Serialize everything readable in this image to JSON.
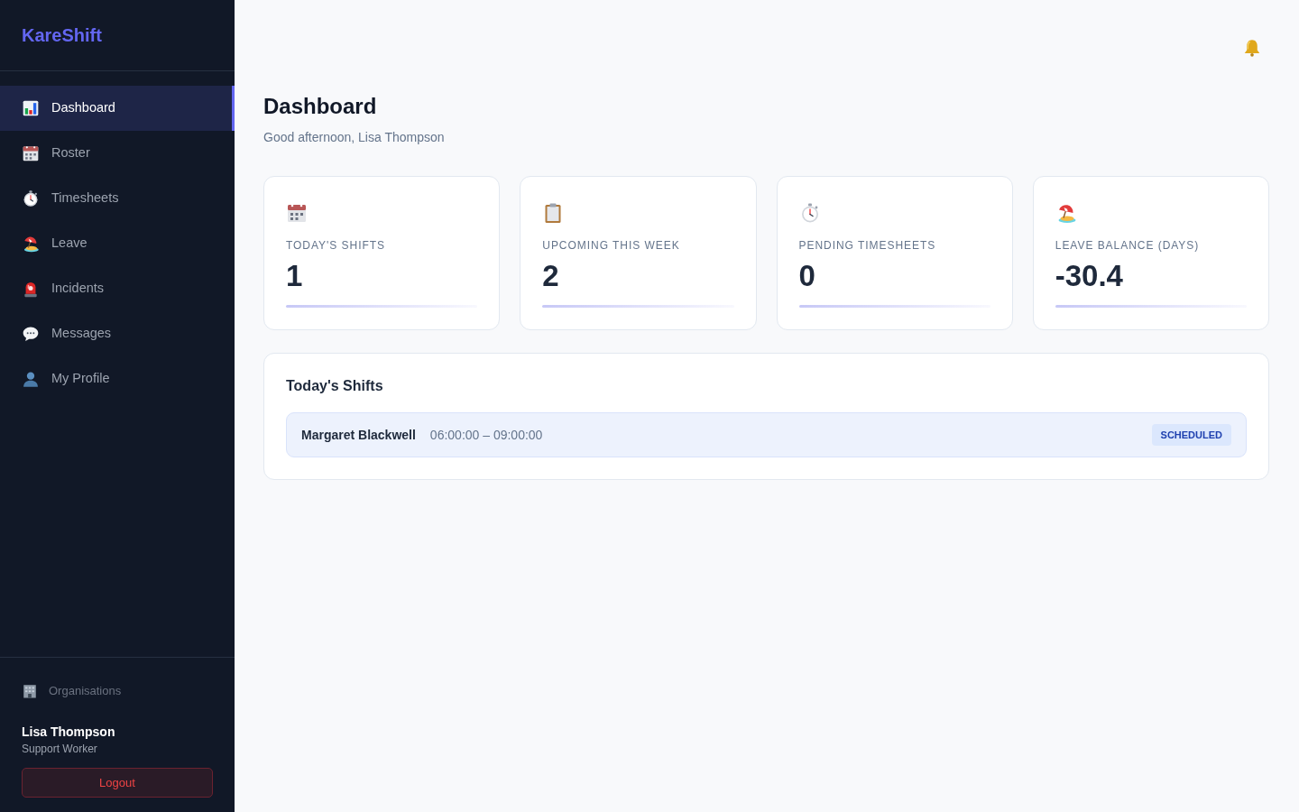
{
  "sidebar": {
    "brand": "KareShift",
    "nav_items": [
      {
        "label": "Dashboard",
        "selected": true
      },
      {
        "label": "Roster",
        "selected": false
      },
      {
        "label": "Timesheets",
        "selected": false
      },
      {
        "label": "Leave",
        "selected": false
      },
      {
        "label": "Incidents",
        "selected": false
      },
      {
        "label": "Messages",
        "selected": false
      },
      {
        "label": "My Profile",
        "selected": false
      }
    ],
    "organisations": "Organisations",
    "user": {
      "name": "Lisa Thompson",
      "role": "Support Worker"
    },
    "logout": "Logout"
  },
  "page": {
    "title": "Dashboard",
    "greeting": "Good afternoon, Lisa Thompson"
  },
  "stats": [
    {
      "label": "TODAY'S SHIFTS",
      "value": "1"
    },
    {
      "label": "UPCOMING THIS WEEK",
      "value": "2"
    },
    {
      "label": "PENDING TIMESHEETS",
      "value": "0"
    },
    {
      "label": "LEAVE BALANCE (DAYS)",
      "value": "-30.4"
    }
  ],
  "shifts_panel": {
    "title": "Today's Shifts",
    "shifts": [
      {
        "client": "Margaret Blackwell",
        "time": "06:00:00 – 09:00:00",
        "status": "SCHEDULED"
      }
    ]
  }
}
